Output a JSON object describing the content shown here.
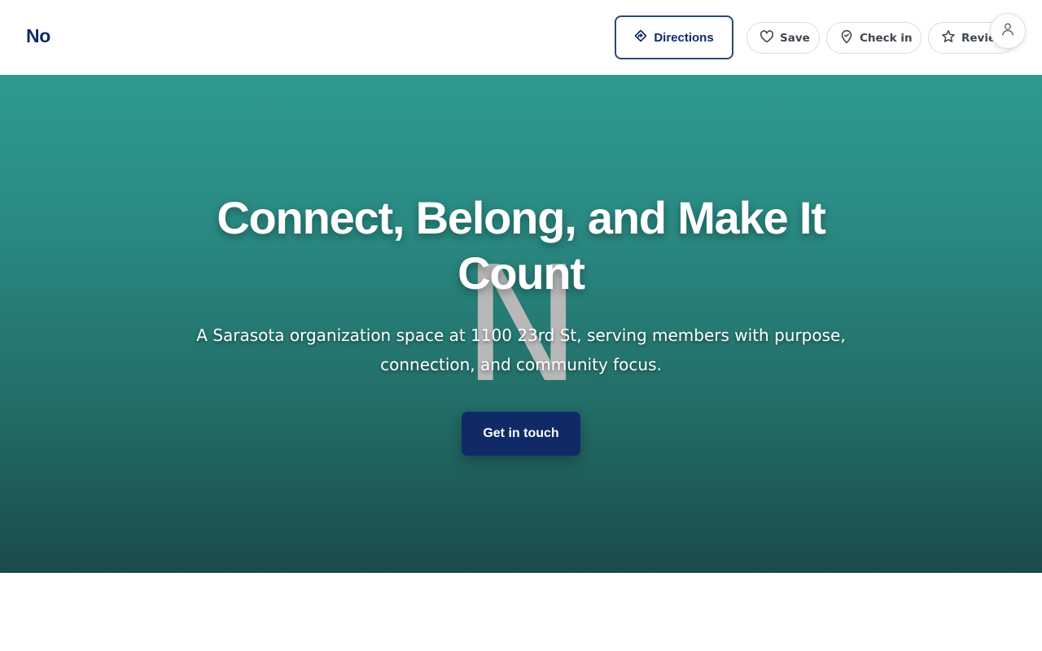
{
  "header": {
    "brand": "No",
    "directions_label": "Directions",
    "save_label": "Save",
    "checkin_label": "Check in",
    "reviews_label": "Reviews"
  },
  "hero": {
    "watermark": "N",
    "title": "Connect, Belong, and Make It Count",
    "subtitle": "A Sarasota organization space at 1100 23rd St, serving members with purpose, connection, and community focus.",
    "cta_label": "Get in touch"
  },
  "icons": {
    "directions": "directions-icon",
    "save": "heart-icon",
    "checkin": "map-pin-icon",
    "reviews": "star-icon",
    "account": "user-icon"
  },
  "colors": {
    "brand": "#0f2a66",
    "hero_top": "#2e9a91",
    "hero_bottom": "#1a4b4a",
    "cta_bg": "#0f2a66"
  }
}
